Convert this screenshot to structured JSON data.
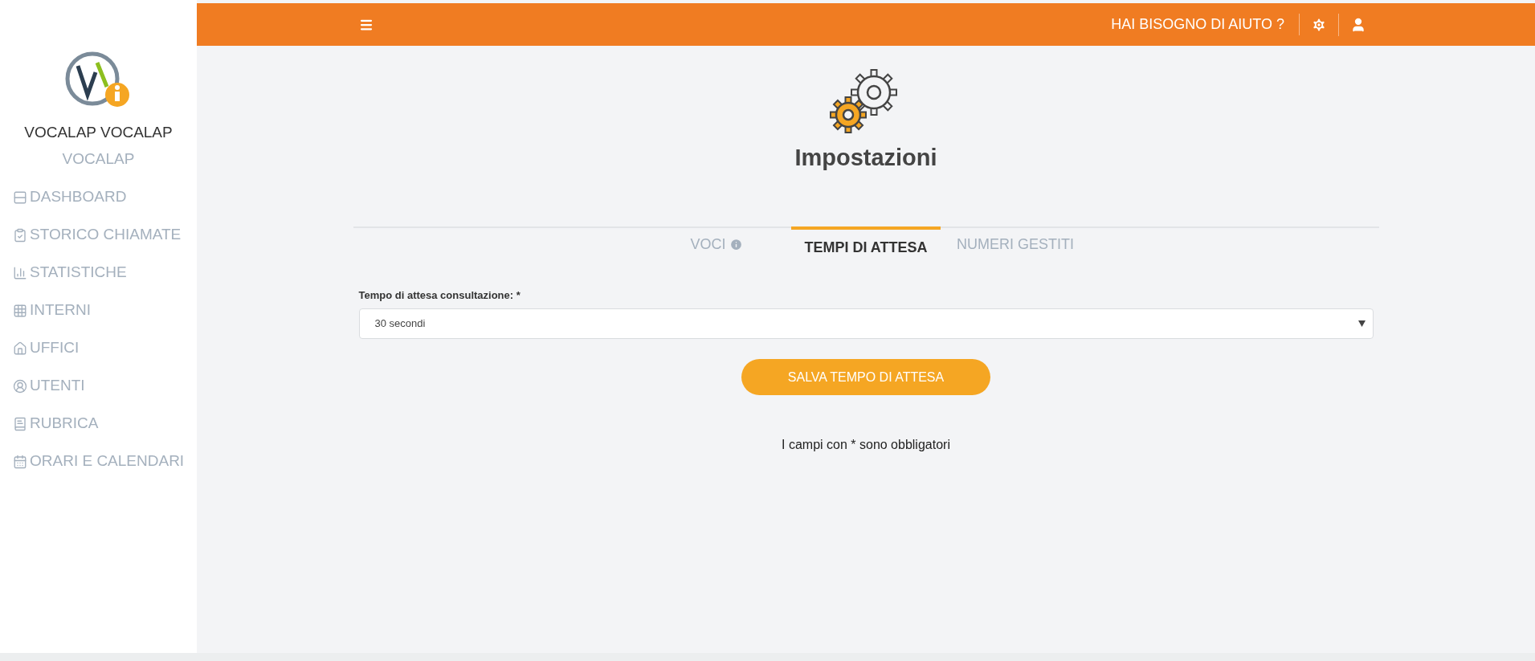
{
  "sidebar": {
    "user_name": "VOCALAP VOCALAP",
    "company": "VOCALAP",
    "items": [
      {
        "label": "DASHBOARD"
      },
      {
        "label": "STORICO CHIAMATE"
      },
      {
        "label": "STATISTICHE"
      },
      {
        "label": "INTERNI"
      },
      {
        "label": "UFFICI"
      },
      {
        "label": "UTENTI"
      },
      {
        "label": "RUBRICA"
      },
      {
        "label": "ORARI E CALENDARI"
      }
    ]
  },
  "header": {
    "help": "HAI BISOGNO DI AIUTO ?"
  },
  "page": {
    "title": "Impostazioni",
    "tabs": [
      {
        "label": "VOCI",
        "info": true,
        "selected": false
      },
      {
        "label": "TEMPI DI ATTESA",
        "info": false,
        "selected": true
      },
      {
        "label": "NUMERI GESTITI",
        "info": false,
        "selected": false
      }
    ],
    "field": {
      "label": "Tempo di attesa consultazione: *",
      "value": "30 secondi"
    },
    "button": "SALVA TEMPO DI ATTESA",
    "note": "I campi con * sono obbligatori"
  }
}
